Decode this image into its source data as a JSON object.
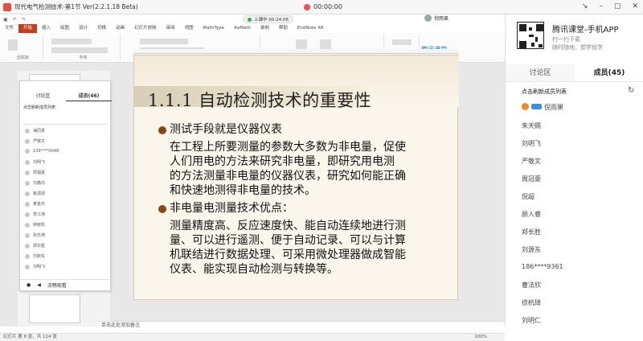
{
  "window": {
    "title": "现代电气检测技术-第1节 Ver(2.2.1.18 Beta)",
    "record_time": "00:00:00",
    "buttons": [
      "↘",
      "–",
      "▢",
      "✕"
    ]
  },
  "ppt": {
    "timer": "上课中 00:24:06",
    "tabs": [
      "文件",
      "开始",
      "插入",
      "绘图",
      "设计",
      "切换",
      "动画",
      "幻灯片放映",
      "审阅",
      "视图",
      "MathType",
      "AxMath",
      "录制",
      "帮助",
      "EndNote X8"
    ],
    "groups": [
      "剪贴板",
      "字体",
      "段落",
      "绘图",
      "编辑"
    ],
    "brand": "腾讯课堂",
    "notes_hint": "单击此处添加备注",
    "status_left": "幻灯片 第 8 张，共 124 张",
    "zoom": "100%"
  },
  "slide": {
    "title": "1.1.1 自动检测技术的重要性",
    "b1": "测试手段就是仪器仪表",
    "p1": [
      "在工程上所要测量的参数大多数为非电量，促使",
      "人们用电的方法来研究非电量，即研究用电测",
      "的方法测量非电量的仪器仪表，研究如何能正确",
      "和快速地测得非电量的技术。"
    ],
    "b2": "非电量电测量技术优点：",
    "p2": [
      "测量精度高、反应速度快、能自动连续地进行测",
      "量、可以进行遥测、便于自动记录、可以与计算",
      "机联结进行数据处理、可采用微处理器做成智能",
      "仪表、能实现自动检测与转换等。"
    ]
  },
  "float_panel": {
    "tabs": [
      "讨论区",
      "成员(46)"
    ],
    "hint": "点击刷新成员列表",
    "members": [
      "海同发",
      "严敬文",
      "139****0048",
      "刘明飞",
      "周福豪",
      "刘鑫向",
      "紫源扭",
      "黄金杰",
      "李江涛",
      "婷晓凯",
      "张仇琦",
      "郑长胜",
      "刘默东",
      "刘明飞"
    ],
    "footer": "流畅观看"
  },
  "right_panel": {
    "app_title": "腾讯课堂-手机APP",
    "app_lines": [
      "扫一扫下载",
      "随时随地，想学就学"
    ],
    "tabs": [
      "讨论区",
      "成员(45)"
    ],
    "refresh": "点击刷新成员列表",
    "me": "倪雨果",
    "members": [
      "朱天赐",
      "刘明飞",
      "严敬文",
      "周冠豪",
      "倪超",
      "顾人睿",
      "郑长胜",
      "刘源东",
      "186****9361",
      "曹法欣",
      "徐杭琦",
      "刘明仁"
    ]
  }
}
